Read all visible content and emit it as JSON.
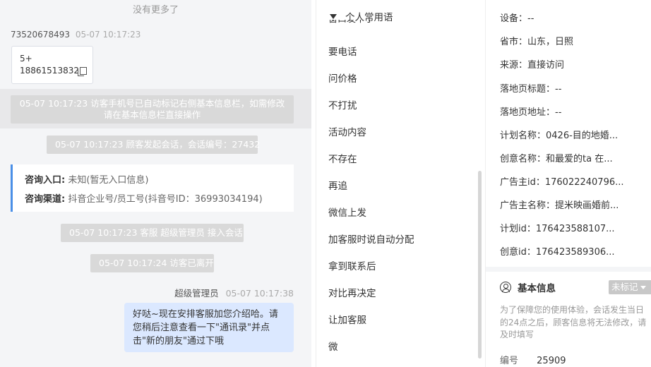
{
  "chat": {
    "no_more": "没有更多了",
    "visitor_msg": {
      "sender": "73520678493",
      "time": "05-07 10:17:23",
      "card_line1": "5+",
      "card_line2": "18861513832"
    },
    "system": [
      "05-07 10:17:23 访客手机号已自动标记右侧基本信息栏，如需修改请在基本信息栏直接操作",
      "05-07 10:17:23 顾客发起会话，会话编号：27432",
      "05-07 10:17:23 客服 超级管理员 接入会话",
      "05-07 10:17:24 访客已离开"
    ],
    "entry": {
      "label1": "咨询入口:",
      "value1": "未知(暂无入口信息)",
      "label2": "咨询渠道:",
      "value2": "抖音企业号/员工号(抖音号ID：36993034194)"
    },
    "agent_msg": {
      "sender": "超级管理员",
      "time": "05-07 10:17:38",
      "text": "好哒~现在安排客服加您介绍哈。请您稍后注意查看一下\"通讯录\"并点击\"新的朋友\"通过下哦"
    }
  },
  "phrases": {
    "header": "个人常用语",
    "cut_item": "窗口发不了",
    "items": [
      "要电话",
      "问价格",
      "不打扰",
      "活动内容",
      "不存在",
      "再追",
      "微信上发",
      "加客服时说自动分配",
      "拿到联系后",
      "对比再决定",
      "让加客服",
      "微"
    ]
  },
  "info": {
    "rows": [
      "设备：--",
      "省市：山东，日照",
      "来源：直接访问",
      "落地页标题：--",
      "落地页地址：--",
      "计划名称：0426-目的地婚...",
      "创意名称：和最爱的ta 在...",
      "广告主id：176022240796...",
      "广告主名称：提米映画婚前...",
      "计划id：176423588107...",
      "创意id：176423589306..."
    ],
    "basic": {
      "title": "基本信息",
      "tag_label": "未标记",
      "note": "为了保障您的使用体验，会话发生当日的24点之后，顾客信息将无法修改，请及时填写",
      "id_label": "编号",
      "id_value": "25909"
    }
  }
}
